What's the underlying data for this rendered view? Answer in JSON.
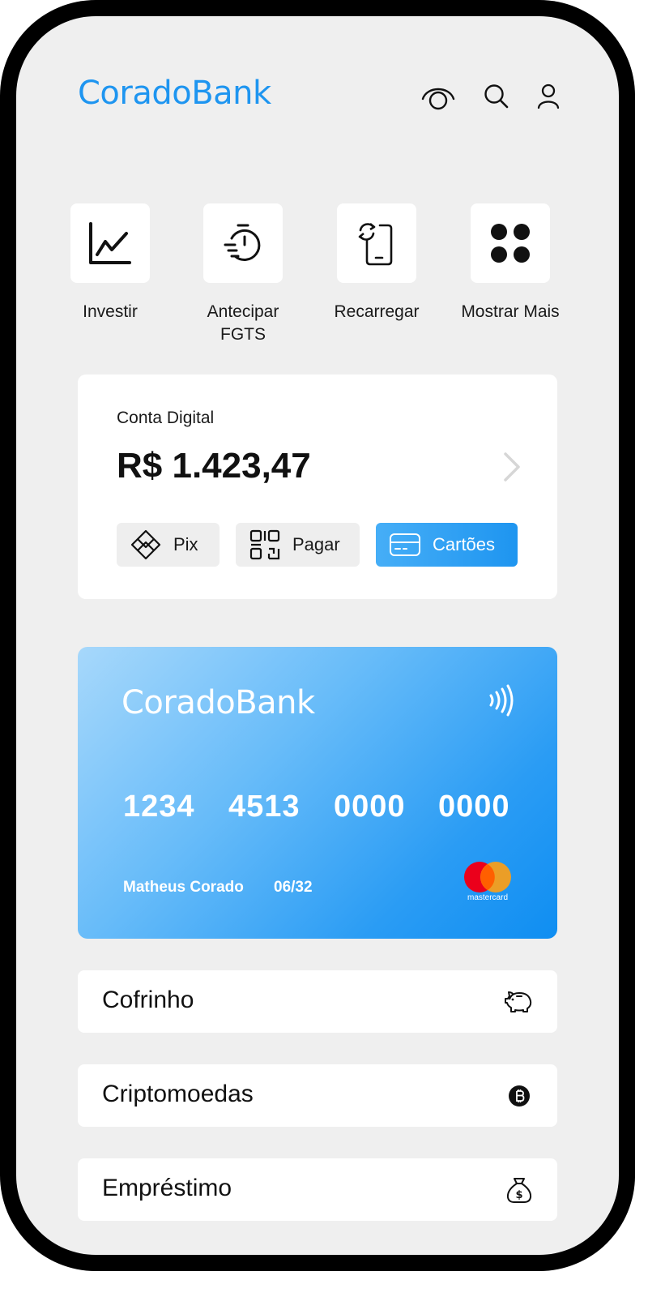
{
  "header": {
    "brand": "CoradoBank",
    "icons": [
      "eye-icon",
      "search-icon",
      "user-icon"
    ]
  },
  "quick_actions": [
    {
      "label": "Investir",
      "icon": "chart-icon"
    },
    {
      "label": "Antecipar\nFGTS",
      "icon": "timer-icon"
    },
    {
      "label": "Recarregar",
      "icon": "phone-refresh-icon"
    },
    {
      "label": "Mostrar Mais",
      "icon": "dots-grid-icon"
    }
  ],
  "account": {
    "title": "Conta Digital",
    "balance": "R$ 1.423,47",
    "actions": [
      {
        "label": "Pix",
        "icon": "pix-icon"
      },
      {
        "label": "Pagar",
        "icon": "qr-icon"
      },
      {
        "label": "Cartões",
        "icon": "card-icon",
        "active": true
      }
    ]
  },
  "card": {
    "brand": "CoradoBank",
    "number_groups": [
      "1234",
      "4513",
      "0000",
      "0000"
    ],
    "holder": "Matheus Corado",
    "expiry": "06/32",
    "network": "mastercard"
  },
  "menu": [
    {
      "label": "Cofrinho",
      "icon": "piggy-bank-icon"
    },
    {
      "label": "Criptomoedas",
      "icon": "bitcoin-icon"
    },
    {
      "label": "Empréstimo",
      "icon": "money-bag-icon"
    }
  ],
  "colors": {
    "brand": "#1e95f0",
    "background": "#efefef",
    "card_gradient_start": "#a7d8fb",
    "card_gradient_end": "#0f8ef2",
    "mastercard_red": "#eb001b",
    "mastercard_orange": "#f79e1b"
  }
}
